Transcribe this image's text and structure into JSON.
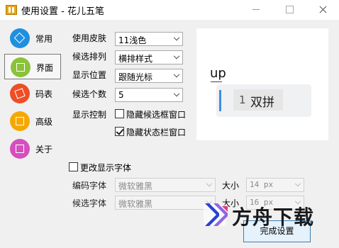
{
  "window": {
    "title": "使用设置 - 花儿五笔",
    "icons": {
      "app": "app-icon",
      "minimize": "minimize-icon",
      "maximize": "maximize-icon",
      "close": "close-icon"
    }
  },
  "sidebar": {
    "items": [
      {
        "label": "常用",
        "icon": "common-icon",
        "color": "#1f8fe0",
        "active": false
      },
      {
        "label": "界面",
        "icon": "layout-icon",
        "color": "#8ac23a",
        "active": true
      },
      {
        "label": "码表",
        "icon": "code-table-icon",
        "color": "#ee4e25",
        "active": false
      },
      {
        "label": "高级",
        "icon": "advanced-icon",
        "color": "#f5a800",
        "active": false
      },
      {
        "label": "关于",
        "icon": "about-icon",
        "color": "#d54fbe",
        "active": false
      }
    ]
  },
  "settings": {
    "skin": {
      "label": "使用皮肤",
      "value": "11浅色"
    },
    "order": {
      "label": "候选排列",
      "value": "横排样式"
    },
    "position": {
      "label": "显示位置",
      "value": "跟随光标"
    },
    "count": {
      "label": "候选个数",
      "value": "5"
    },
    "display_control": {
      "label": "显示控制",
      "hide_candidate_window": {
        "label": "隐藏候选框窗口",
        "checked": false
      },
      "hide_statusbar_window": {
        "label": "隐藏状态栏窗口",
        "checked": true
      }
    },
    "change_font": {
      "label": "更改显示字体",
      "checked": false
    },
    "code_font": {
      "label": "编码字体",
      "value": "微软雅黑",
      "size_label": "大小",
      "size_value": "14 px"
    },
    "candidate_font": {
      "label": "候选字体",
      "value": "微软雅黑",
      "size_label": "大小",
      "size_value": "16 px"
    }
  },
  "preview": {
    "input": "up",
    "candidate_number": "1",
    "candidate_text": "双拼",
    "accent": "#3c8ee0"
  },
  "buttons": {
    "finish": "完成设置"
  },
  "watermark": {
    "text": "方舟下载",
    "icon": "watermark-logo-icon"
  }
}
